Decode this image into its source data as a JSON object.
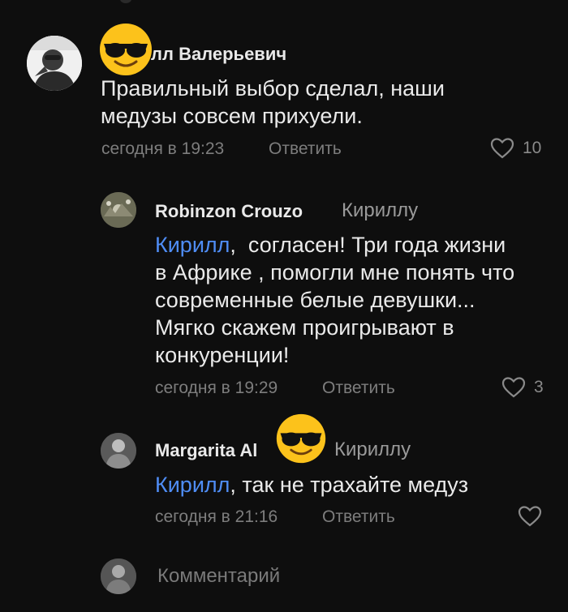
{
  "comments": [
    {
      "author": "лл Валерьевич",
      "text_line1": "Правильный выбор сделал, наши",
      "text_line2": "медузы совсем прихуели.",
      "time": "сегодня в 19:23",
      "reply_label": "Ответить",
      "likes": "10"
    },
    {
      "author": "Robinzon Crouzo",
      "reply_to": "Кириллу",
      "mention": "Кирилл",
      "text_line1_rest": ",  согласен! Три года жизни",
      "text_line2": "в Африке , помогли мне понять что",
      "text_line3": "современные белые девушки...",
      "text_line4": "Мягко скажем проигрывают в",
      "text_line5": "конкуренции!",
      "time": "сегодня в 19:29",
      "reply_label": "Ответить",
      "likes": "3"
    },
    {
      "author": "Margarita Al",
      "reply_to": "Кириллу",
      "mention": "Кирилл",
      "text_rest": ", так не трахайте медуз",
      "time": "сегодня в 21:16",
      "reply_label": "Ответить",
      "likes": ""
    }
  ],
  "composer": {
    "placeholder": "Комментарий"
  },
  "icons": {
    "like": "heart-icon",
    "censor": "sunglasses-emoji-icon"
  },
  "colors": {
    "background": "#0e0e0e",
    "mention": "#4f8df5",
    "meta": "#7d7d7d"
  }
}
